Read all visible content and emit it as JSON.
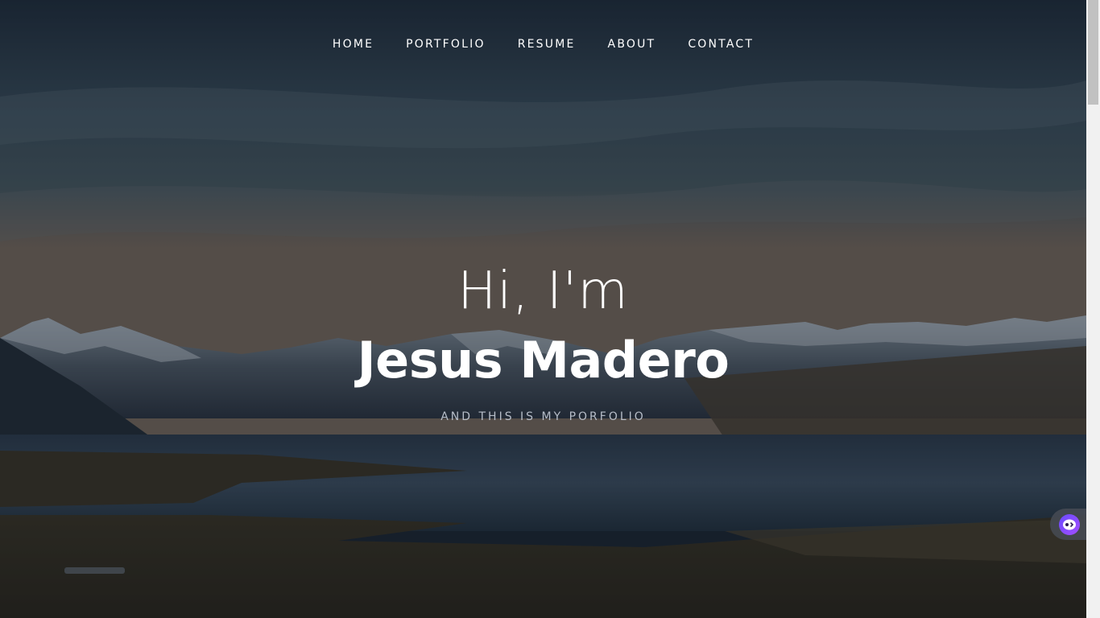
{
  "nav": {
    "items": [
      {
        "label": "HOME"
      },
      {
        "label": "PORTFOLIO"
      },
      {
        "label": "RESUME"
      },
      {
        "label": "ABOUT"
      },
      {
        "label": "CONTACT"
      }
    ]
  },
  "intro": {
    "greeting": "Hi, I'm",
    "name": "Jesus Madero",
    "tagline": "AND THIS IS MY PORFOLIO"
  },
  "widget": {
    "icon": "chat-bot-icon"
  },
  "colors": {
    "text": "#ffffff",
    "tagline": "#b6bdc8",
    "widget_accent": "#7b4dff"
  }
}
